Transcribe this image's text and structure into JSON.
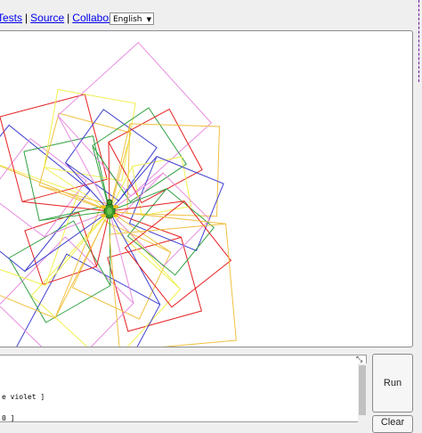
{
  "nav": {
    "tests_label": "Tests",
    "source_label": "Source",
    "collaborate_label": "Collaborate",
    "separator": "|"
  },
  "language": {
    "selected": "English",
    "arrow_icon": "chevron-down-icon"
  },
  "drawing": {
    "colors": [
      "#e62020",
      "#f0c040",
      "#f0f050",
      "#4040d0",
      "#e88ce0",
      "#30a040"
    ],
    "turtle_icon": "turtle-icon"
  },
  "code_editor": {
    "lines": [
      "e violet ]",
      "",
      "0 ]"
    ]
  },
  "buttons": {
    "run_label": "Run",
    "clear_label": "Clear"
  }
}
